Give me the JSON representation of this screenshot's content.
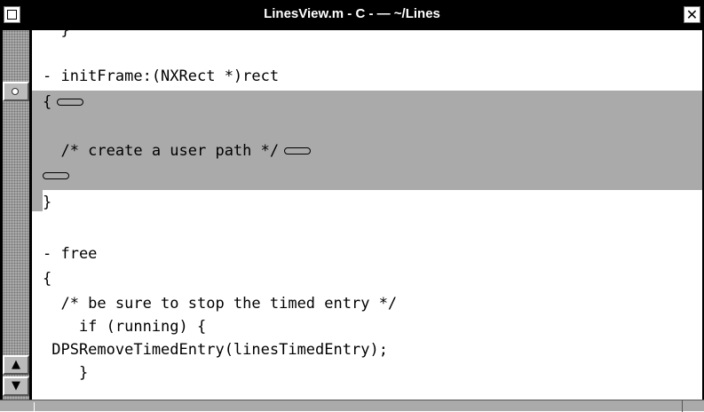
{
  "window": {
    "title": "LinesView.m - C -  — ~/Lines",
    "close_glyph": "✕"
  },
  "scroller": {
    "up_arrow": "▲",
    "down_arrow": "▼"
  },
  "editor": {
    "lines": [
      {
        "text": "  }"
      },
      {
        "text": ""
      },
      {
        "text": "- initFrame:(NXRect *)rect"
      },
      {
        "text": "{",
        "tab": true
      },
      {
        "text": ""
      },
      {
        "text": "  /* create a user path */",
        "tab": true
      },
      {
        "text": "",
        "tab": true
      },
      {
        "text": "}"
      },
      {
        "text": ""
      },
      {
        "text": ""
      },
      {
        "text": "- free"
      },
      {
        "text": "{"
      },
      {
        "text": "  /* be sure to stop the timed entry */"
      },
      {
        "text": "    if (running) {"
      },
      {
        "text": " DPSRemoveTimedEntry(linesTimedEntry);"
      },
      {
        "text": "    }"
      }
    ]
  },
  "colors": {
    "selection": "#aaaaaa",
    "titlebar": "#000000"
  }
}
